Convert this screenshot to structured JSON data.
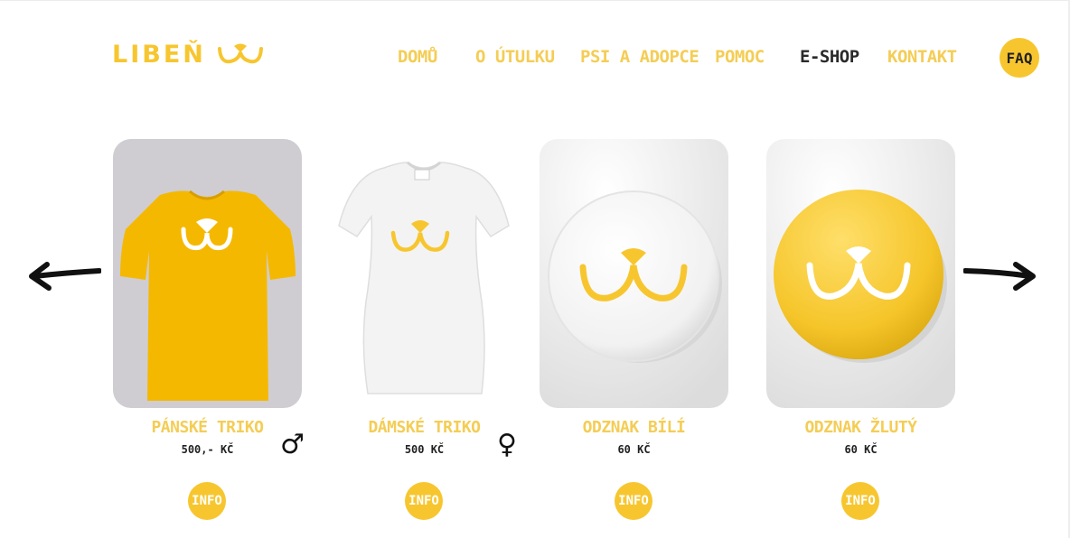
{
  "colors": {
    "brand_yellow": "#f7c62f",
    "nav_yellow": "#f4cd55",
    "active_nav": "#2a2a2a",
    "text_dark": "#222222"
  },
  "logo": {
    "text": "LIBEŇ",
    "icon": "cat-mouth-icon"
  },
  "nav": {
    "items": [
      {
        "label": "DOMŮ",
        "active": false
      },
      {
        "label": "O ÚTULKU",
        "active": false
      },
      {
        "label": "PSI A ADOPCE",
        "active": false
      },
      {
        "label": "POMOC",
        "active": false
      },
      {
        "label": "E-SHOP",
        "active": true
      },
      {
        "label": "KONTAKT",
        "active": false
      }
    ],
    "faq_label": "FAQ"
  },
  "carousel": {
    "prev_icon": "arrow-left-icon",
    "next_icon": "arrow-right-icon",
    "products": [
      {
        "name": "PÁNSKÉ TRIKO",
        "price": "500,- KČ",
        "info_label": "INFO",
        "gender_symbol": "♂",
        "image": "yellow-tshirt"
      },
      {
        "name": "DÁMSKÉ TRIKO",
        "price": "500 KČ",
        "info_label": "INFO",
        "gender_symbol": "♀",
        "image": "white-tshirt"
      },
      {
        "name": "ODZNAK BÍLÍ",
        "price": "60 KČ",
        "info_label": "INFO",
        "image": "white-badge"
      },
      {
        "name": "ODZNAK ŽLUTÝ",
        "price": "60 KČ",
        "info_label": "INFO",
        "image": "yellow-badge"
      }
    ]
  }
}
